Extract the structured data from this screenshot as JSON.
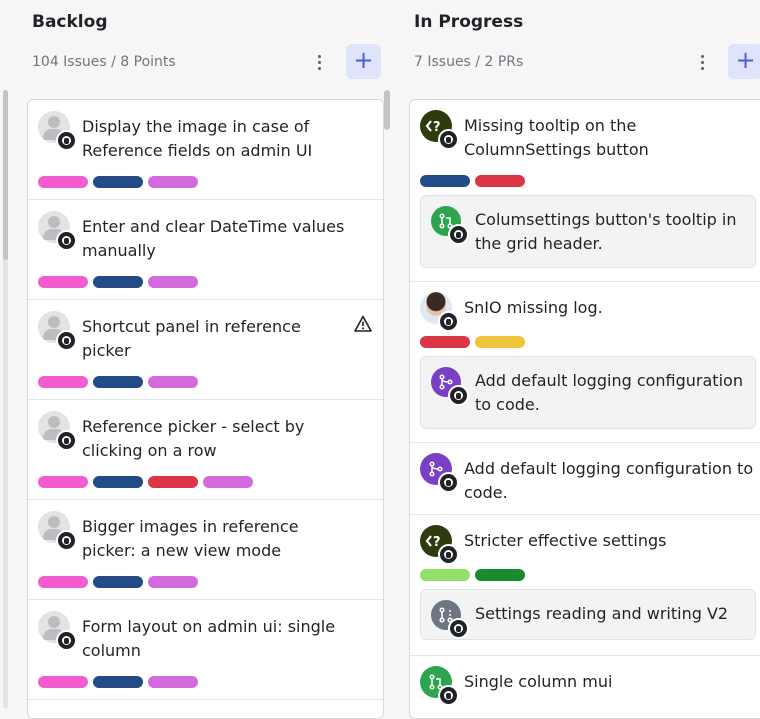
{
  "backlog": {
    "title": "Backlog",
    "summary": "104 Issues / 8 Points",
    "add_label": "+",
    "cards": [
      {
        "title": "Display the image in case of Reference fields on admin UI",
        "tags": [
          "#f25ccf",
          "#234b85",
          "#d36bdc"
        ]
      },
      {
        "title": "Enter and clear DateTime values manually",
        "tags": [
          "#f25ccf",
          "#234b85",
          "#d36bdc"
        ]
      },
      {
        "title": "Shortcut panel in reference picker",
        "tags": [
          "#f25ccf",
          "#234b85",
          "#d36bdc"
        ],
        "warning": true
      },
      {
        "title": "Reference picker - select by clicking on a row",
        "tags": [
          "#f25ccf",
          "#234b85",
          "#dc3545",
          "#d36bdc"
        ]
      },
      {
        "title": "Bigger images in reference picker: a new view mode",
        "tags": [
          "#f25ccf",
          "#234b85",
          "#d36bdc"
        ]
      },
      {
        "title": "Form layout on admin ui: single column",
        "tags": [
          "#f25ccf",
          "#234b85",
          "#d36bdc"
        ]
      }
    ]
  },
  "in_progress": {
    "title": "In Progress",
    "summary": "7 Issues / 2 PRs",
    "add_label": "+",
    "cards": [
      {
        "title": "Missing tooltip on the ColumnSettings button",
        "avatar": "question-icon",
        "tags": [
          "#234b85",
          "#dc3545"
        ],
        "sub": {
          "title": "Columsettings button's tooltip in the grid header.",
          "icon": "pull-request-icon",
          "color": "#2da44e"
        }
      },
      {
        "title": "SnIO missing log.",
        "avatar": "user-photo",
        "tags": [
          "#dc3545",
          "#f0c53c"
        ],
        "sub": {
          "title": "Add default logging configuration to code.",
          "icon": "branch-icon",
          "color": "#7a3fc4"
        }
      },
      {
        "title": "Add default logging configuration to code.",
        "avatar": "branch-icon",
        "avatar_color": "#7a3fc4"
      },
      {
        "title": "Stricter effective settings",
        "avatar": "question-icon",
        "tags": [
          "#92e06a",
          "#1a8a2e"
        ],
        "sub": {
          "title": "Settings reading and writing V2",
          "icon": "draft-pr-icon",
          "color": "#6e7781"
        }
      },
      {
        "title": "Single column mui",
        "avatar": "pull-request-icon",
        "avatar_color": "#2da44e"
      }
    ]
  }
}
